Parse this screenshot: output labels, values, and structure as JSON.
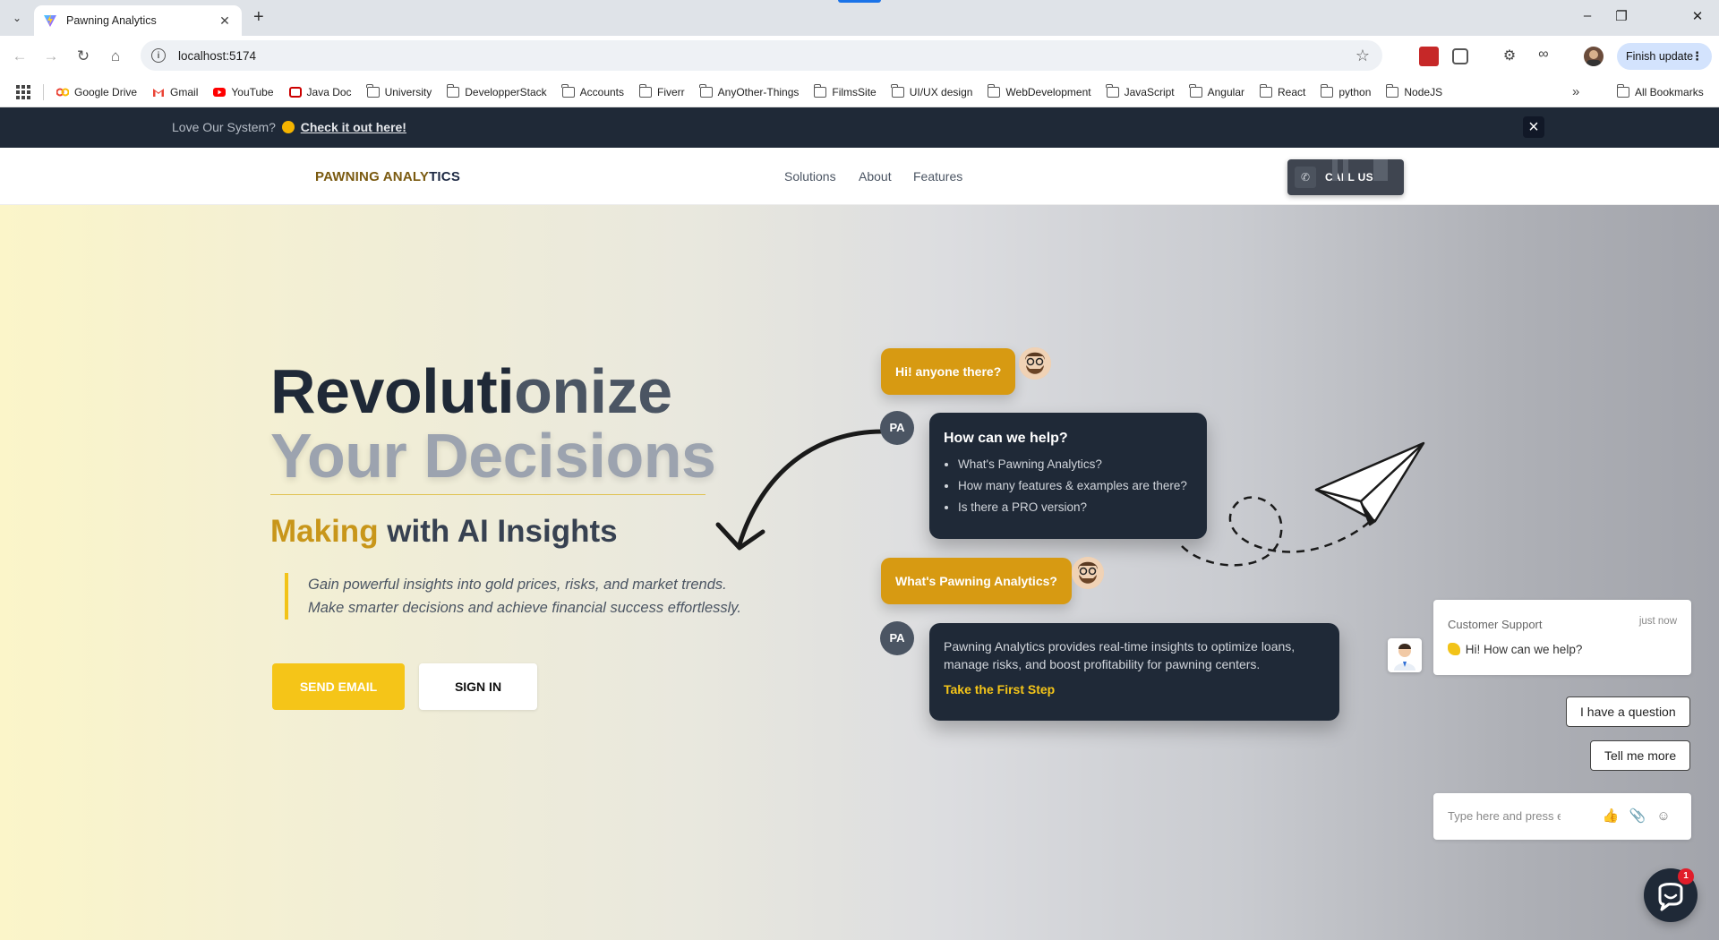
{
  "browser": {
    "tab_title": "Pawning Analytics",
    "url": "localhost:5174",
    "finish_update": "Finish update",
    "bookmarks": [
      "Google Drive",
      "Gmail",
      "YouTube",
      "Java Doc",
      "University",
      "DevelopperStack",
      "Accounts",
      "Fiverr",
      "AnyOther-Things",
      "FilmsSite",
      "UI/UX design",
      "WebDevelopment",
      "JavaScript",
      "Angular",
      "React",
      "python",
      "NodeJS"
    ],
    "all_bookmarks": "All Bookmarks"
  },
  "announcement": {
    "text": "Love Our System?",
    "link": "Check it out here!"
  },
  "navbar": {
    "logo_part1": "PAWNING ANALY",
    "logo_part2": "TICS",
    "links": [
      "Solutions",
      "About",
      "Features"
    ],
    "call_label": "CALL US"
  },
  "hero": {
    "title_line1a": "Revoluti",
    "title_line1b": "onize",
    "title_line2": "Your Decisions",
    "subtitle_gold": "Making",
    "subtitle_rest": " with AI Insights",
    "quote_line1": "Gain powerful insights into gold prices, risks, and market trends.",
    "quote_line2": "Make smarter decisions and achieve financial success effortlessly.",
    "btn_email": "SEND EMAIL",
    "btn_signin": "SIGN IN"
  },
  "chat_demo": {
    "user_msg1": "Hi! anyone there?",
    "bot_avatar": "PA",
    "bot1_title": "How can we help?",
    "bot1_items": [
      "What's Pawning Analytics?",
      "How many features & examples are there?",
      "Is there a PRO version?"
    ],
    "user_msg2": "What's Pawning Analytics?",
    "bot2_text": "Pawning Analytics provides real-time insights to optimize loans, manage risks, and boost profitability for pawning centers.",
    "bot2_link": "Take the First Step"
  },
  "support_widget": {
    "title": "Customer Support",
    "time": "just now",
    "message": "Hi! How can we help?",
    "quick_replies": [
      "I have a question",
      "Tell me more"
    ],
    "input_placeholder": "Type here and press enter..",
    "badge_count": "1"
  },
  "colors": {
    "dark": "#1f2937",
    "gold": "#f5c518",
    "bubble_gold": "#d79a12"
  }
}
